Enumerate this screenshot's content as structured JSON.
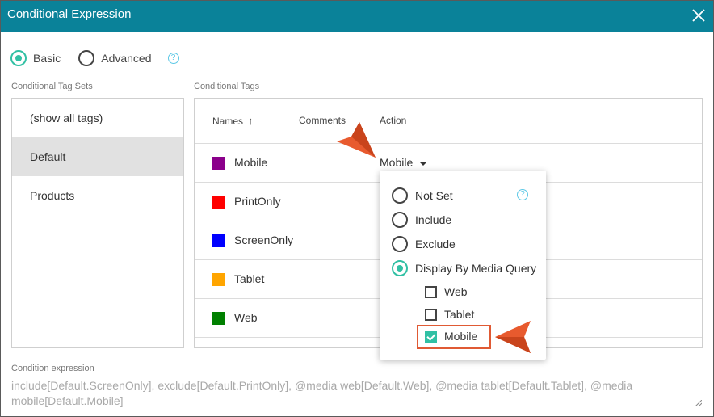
{
  "dialog": {
    "title": "Conditional Expression"
  },
  "mode": {
    "basic_label": "Basic",
    "advanced_label": "Advanced",
    "selected": "basic"
  },
  "tag_sets": {
    "label": "Conditional Tag Sets",
    "items": [
      {
        "label": "(show all tags)",
        "selected": false
      },
      {
        "label": "Default",
        "selected": true
      },
      {
        "label": "Products",
        "selected": false
      }
    ]
  },
  "tags": {
    "label": "Conditional Tags",
    "columns": {
      "names": "Names",
      "comments": "Comments",
      "action": "Action"
    },
    "rows": [
      {
        "name": "Mobile",
        "color": "#8b008b",
        "action": "Mobile"
      },
      {
        "name": "PrintOnly",
        "color": "#ff0000",
        "action": ""
      },
      {
        "name": "ScreenOnly",
        "color": "#0000ff",
        "action": ""
      },
      {
        "name": "Tablet",
        "color": "#ffa500",
        "action": ""
      },
      {
        "name": "Web",
        "color": "#008000",
        "action": ""
      }
    ]
  },
  "action_menu": {
    "options": [
      {
        "label": "Not Set",
        "selected": false
      },
      {
        "label": "Include",
        "selected": false
      },
      {
        "label": "Exclude",
        "selected": false
      },
      {
        "label": "Display By Media Query",
        "selected": true
      }
    ],
    "media": [
      {
        "label": "Web",
        "checked": false
      },
      {
        "label": "Tablet",
        "checked": false
      },
      {
        "label": "Mobile",
        "checked": true
      }
    ]
  },
  "expression": {
    "label": "Condition expression",
    "value": "include[Default.ScreenOnly], exclude[Default.PrintOnly], @media web[Default.Web], @media tablet[Default.Tablet], @media mobile[Default.Mobile]"
  },
  "colors": {
    "titlebar": "#0a8299",
    "accent": "#31c0a4",
    "callout": "#e05a34"
  }
}
